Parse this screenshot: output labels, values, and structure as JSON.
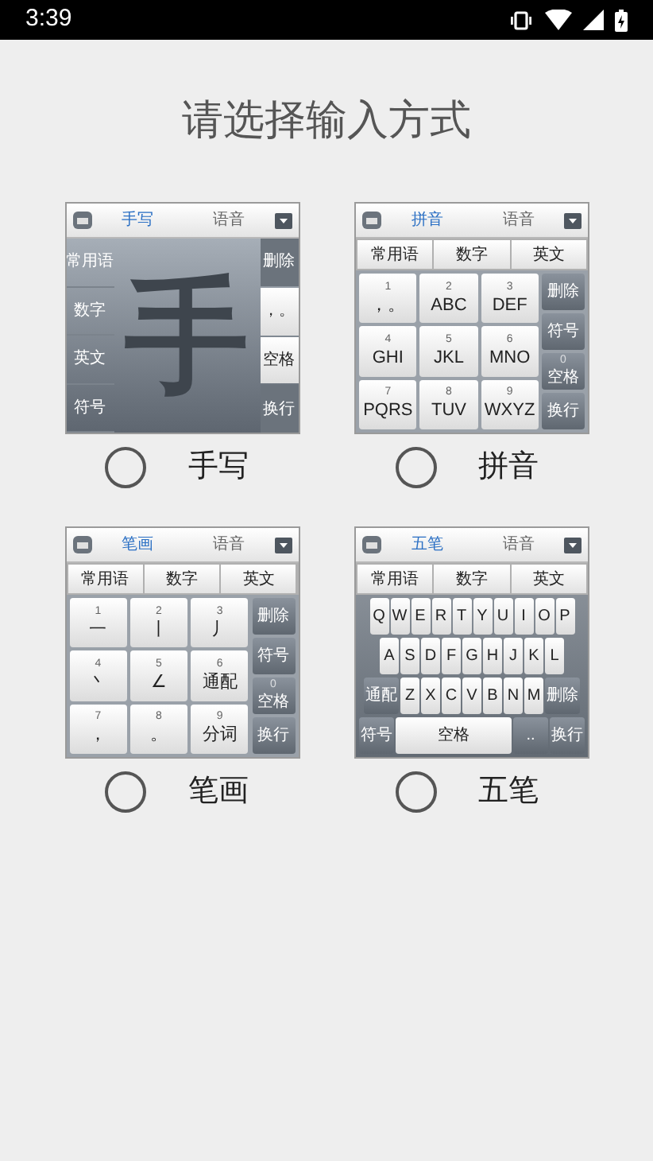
{
  "status_bar": {
    "time": "3:39"
  },
  "title": "请选择输入方式",
  "options": [
    {
      "label": "手写",
      "selected": false,
      "preview": {
        "kind": "handwriting",
        "tabs": [
          {
            "label": "手写",
            "selected": true
          },
          {
            "label": "语音",
            "selected": false
          }
        ],
        "left_keys": [
          "常用语",
          "数字",
          "英文",
          "符号"
        ],
        "glyph": "手",
        "right_keys": [
          {
            "label": "删除",
            "kind": "function"
          },
          {
            "label": "，。",
            "kind": "char"
          },
          {
            "label": "空格",
            "kind": "char"
          },
          {
            "label": "换行",
            "kind": "function"
          }
        ]
      }
    },
    {
      "label": "拼音",
      "selected": false,
      "preview": {
        "kind": "grid",
        "tabs": [
          {
            "label": "拼音",
            "selected": true
          },
          {
            "label": "语音",
            "selected": false
          }
        ],
        "top_row": [
          "常用语",
          "数字",
          "英文"
        ],
        "keys": [
          {
            "number": "1",
            "label": "，。"
          },
          {
            "number": "2",
            "label": "ABC"
          },
          {
            "number": "3",
            "label": "DEF"
          },
          {
            "number": "4",
            "label": "GHI"
          },
          {
            "number": "5",
            "label": "JKL"
          },
          {
            "number": "6",
            "label": "MNO"
          },
          {
            "number": "7",
            "label": "PQRS"
          },
          {
            "number": "8",
            "label": "TUV"
          },
          {
            "number": "9",
            "label": "WXYZ"
          }
        ],
        "side_keys": [
          {
            "label": "删除"
          },
          {
            "label": "符号"
          },
          {
            "number": "0",
            "label": "空格"
          },
          {
            "label": "换行"
          }
        ]
      }
    },
    {
      "label": "笔画",
      "selected": false,
      "preview": {
        "kind": "grid",
        "tabs": [
          {
            "label": "笔画",
            "selected": true
          },
          {
            "label": "语音",
            "selected": false
          }
        ],
        "top_row": [
          "常用语",
          "数字",
          "英文"
        ],
        "keys": [
          {
            "number": "1",
            "label": "一"
          },
          {
            "number": "2",
            "label": "丨"
          },
          {
            "number": "3",
            "label": "丿"
          },
          {
            "number": "4",
            "label": "丶"
          },
          {
            "number": "5",
            "label": "∠"
          },
          {
            "number": "6",
            "label": "通配"
          },
          {
            "number": "7",
            "label": "，"
          },
          {
            "number": "8",
            "label": "。"
          },
          {
            "number": "9",
            "label": "分词"
          }
        ],
        "side_keys": [
          {
            "label": "删除"
          },
          {
            "label": "符号"
          },
          {
            "number": "0",
            "label": "空格"
          },
          {
            "label": "换行"
          }
        ]
      }
    },
    {
      "label": "五笔",
      "selected": false,
      "preview": {
        "kind": "qwerty",
        "tabs": [
          {
            "label": "五笔",
            "selected": true
          },
          {
            "label": "语音",
            "selected": false
          }
        ],
        "top_row": [
          "常用语",
          "数字",
          "英文"
        ],
        "key_rows": [
          {
            "keys": [
              {
                "label": "Q",
                "kind": "char"
              },
              {
                "label": "W",
                "kind": "char"
              },
              {
                "label": "E",
                "kind": "char"
              },
              {
                "label": "R",
                "kind": "char"
              },
              {
                "label": "T",
                "kind": "char"
              },
              {
                "label": "Y",
                "kind": "char"
              },
              {
                "label": "U",
                "kind": "char"
              },
              {
                "label": "I",
                "kind": "char"
              },
              {
                "label": "O",
                "kind": "char"
              },
              {
                "label": "P",
                "kind": "char"
              }
            ]
          },
          {
            "keys": [
              {
                "label": "A",
                "kind": "char"
              },
              {
                "label": "S",
                "kind": "char"
              },
              {
                "label": "D",
                "kind": "char"
              },
              {
                "label": "F",
                "kind": "char"
              },
              {
                "label": "G",
                "kind": "char"
              },
              {
                "label": "H",
                "kind": "char"
              },
              {
                "label": "J",
                "kind": "char"
              },
              {
                "label": "K",
                "kind": "char"
              },
              {
                "label": "L",
                "kind": "char"
              }
            ]
          },
          {
            "keys": [
              {
                "label": "通配",
                "kind": "function"
              },
              {
                "label": "Z",
                "kind": "char"
              },
              {
                "label": "X",
                "kind": "char"
              },
              {
                "label": "C",
                "kind": "char"
              },
              {
                "label": "V",
                "kind": "char"
              },
              {
                "label": "B",
                "kind": "char"
              },
              {
                "label": "N",
                "kind": "char"
              },
              {
                "label": "M",
                "kind": "char"
              },
              {
                "label": "删除",
                "kind": "function"
              }
            ]
          },
          {
            "keys": [
              {
                "label": "符号",
                "kind": "function"
              },
              {
                "label": "空格",
                "kind": "space"
              },
              {
                "label": "..",
                "kind": "function"
              },
              {
                "label": "换行",
                "kind": "function"
              }
            ]
          }
        ]
      }
    }
  ]
}
